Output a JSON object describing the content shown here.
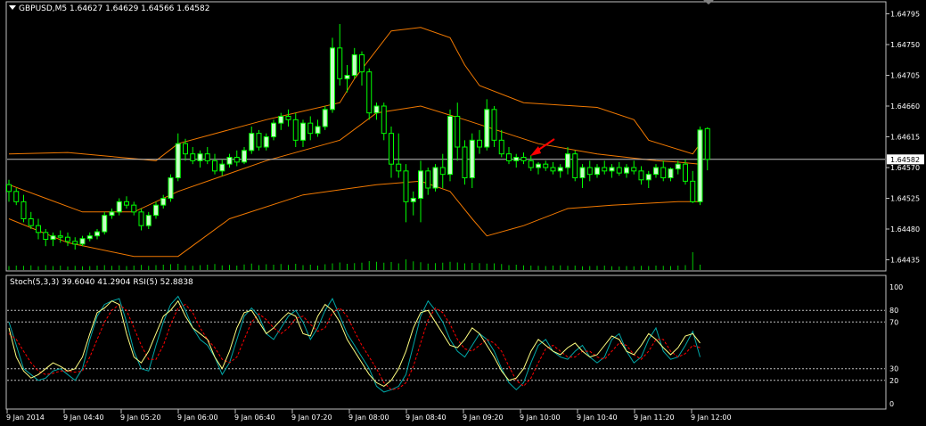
{
  "main_chart": {
    "header": "GBPUSD,M5  1.64627 1.64629 1.64566 1.64582",
    "price_labels": [
      "1.64795",
      "1.64750",
      "1.64705",
      "1.64660",
      "1.64615",
      "1.64570",
      "1.64525",
      "1.64480",
      "1.64435"
    ],
    "current_price_label": "1.64582",
    "current_price": 1.64582,
    "colors": {
      "bull": "#c8ffc8",
      "bear": "#000000",
      "wick": "#00ff00",
      "bands": "#f07800",
      "volume": "#00c800",
      "grid": "#c0c0c0",
      "arrow": "#ff0000",
      "price_line": "#c0c0c0"
    }
  },
  "indicator": {
    "header": "Stoch(5,3,3) 39.6040 41.2904  RSI(5) 52.8838",
    "levels": [
      "100",
      "80",
      "70",
      "30",
      "20",
      "0"
    ],
    "colors": {
      "stoch_main": "#00a8a8",
      "stoch_signal": "#ff0000",
      "rsi": "#ffff80"
    }
  },
  "time_axis": {
    "labels": [
      "9 Jan 2014",
      "9 Jan 04:40",
      "9 Jan 05:20",
      "9 Jan 06:00",
      "9 Jan 06:40",
      "9 Jan 07:20",
      "9 Jan 08:00",
      "9 Jan 08:40",
      "9 Jan 09:20",
      "9 Jan 10:00",
      "9 Jan 10:40",
      "9 Jan 11:20",
      "9 Jan 12:00"
    ]
  },
  "chart_data": {
    "type": "candlestick",
    "symbol": "GBPUSD",
    "timeframe": "M5",
    "ohlc_last": {
      "open": 1.64627,
      "high": 1.64629,
      "low": 1.64566,
      "close": 1.64582
    },
    "ylim": [
      1.6442,
      1.6481
    ],
    "candles": [
      [
        1.64545,
        1.64552,
        1.6452,
        1.64535
      ],
      [
        1.64535,
        1.6454,
        1.64515,
        1.6452
      ],
      [
        1.6452,
        1.6453,
        1.6449,
        1.64495
      ],
      [
        1.64495,
        1.64505,
        1.6448,
        1.64485
      ],
      [
        1.64485,
        1.64495,
        1.64465,
        1.64475
      ],
      [
        1.64475,
        1.6448,
        1.64455,
        1.64465
      ],
      [
        1.64465,
        1.64475,
        1.64455,
        1.6447
      ],
      [
        1.6447,
        1.64478,
        1.6446,
        1.64468
      ],
      [
        1.64468,
        1.64475,
        1.64455,
        1.64462
      ],
      [
        1.64462,
        1.64468,
        1.6445,
        1.64458
      ],
      [
        1.64458,
        1.6447,
        1.64455,
        1.64466
      ],
      [
        1.64466,
        1.64475,
        1.64462,
        1.6447
      ],
      [
        1.6447,
        1.6448,
        1.64465,
        1.64476
      ],
      [
        1.64476,
        1.64505,
        1.64472,
        1.645
      ],
      [
        1.645,
        1.6451,
        1.64495,
        1.64505
      ],
      [
        1.64505,
        1.64525,
        1.645,
        1.6452
      ],
      [
        1.6452,
        1.64528,
        1.6451,
        1.64515
      ],
      [
        1.64515,
        1.6452,
        1.645,
        1.64505
      ],
      [
        1.64505,
        1.6451,
        1.64478,
        1.64485
      ],
      [
        1.64485,
        1.64505,
        1.6448,
        1.645
      ],
      [
        1.645,
        1.6452,
        1.64495,
        1.64515
      ],
      [
        1.64515,
        1.6453,
        1.6451,
        1.64525
      ],
      [
        1.64525,
        1.6456,
        1.6452,
        1.64555
      ],
      [
        1.64555,
        1.6462,
        1.6455,
        1.64605
      ],
      [
        1.64605,
        1.64612,
        1.6458,
        1.6459
      ],
      [
        1.6459,
        1.646,
        1.64575,
        1.6458
      ],
      [
        1.6458,
        1.64595,
        1.6457,
        1.6459
      ],
      [
        1.6459,
        1.646,
        1.64575,
        1.6458
      ],
      [
        1.6458,
        1.6459,
        1.6456,
        1.64565
      ],
      [
        1.64565,
        1.64582,
        1.64558,
        1.64575
      ],
      [
        1.64575,
        1.6459,
        1.6457,
        1.64585
      ],
      [
        1.64585,
        1.64595,
        1.64572,
        1.64578
      ],
      [
        1.64578,
        1.646,
        1.64575,
        1.64595
      ],
      [
        1.64595,
        1.6463,
        1.6459,
        1.6462
      ],
      [
        1.6462,
        1.64625,
        1.64595,
        1.646
      ],
      [
        1.646,
        1.6462,
        1.64595,
        1.64615
      ],
      [
        1.64615,
        1.6464,
        1.6461,
        1.64635
      ],
      [
        1.64635,
        1.6465,
        1.64625,
        1.64645
      ],
      [
        1.64645,
        1.64655,
        1.6463,
        1.6464
      ],
      [
        1.6464,
        1.6465,
        1.646,
        1.6461
      ],
      [
        1.6461,
        1.6464,
        1.646,
        1.64635
      ],
      [
        1.64635,
        1.64645,
        1.6461,
        1.6462
      ],
      [
        1.6462,
        1.6464,
        1.64615,
        1.6463
      ],
      [
        1.6463,
        1.6466,
        1.64625,
        1.64655
      ],
      [
        1.64655,
        1.6476,
        1.6465,
        1.64745
      ],
      [
        1.64745,
        1.6478,
        1.6469,
        1.647
      ],
      [
        1.647,
        1.6472,
        1.6468,
        1.64705
      ],
      [
        1.64705,
        1.64745,
        1.647,
        1.64735
      ],
      [
        1.64735,
        1.6474,
        1.6469,
        1.6471
      ],
      [
        1.6471,
        1.64715,
        1.6464,
        1.6465
      ],
      [
        1.6465,
        1.64665,
        1.6464,
        1.6466
      ],
      [
        1.6466,
        1.64665,
        1.6461,
        1.6462
      ],
      [
        1.6462,
        1.6463,
        1.64555,
        1.64575
      ],
      [
        1.64575,
        1.6462,
        1.64555,
        1.64565
      ],
      [
        1.64565,
        1.64575,
        1.6449,
        1.6452
      ],
      [
        1.6452,
        1.64535,
        1.645,
        1.64525
      ],
      [
        1.64525,
        1.6458,
        1.6449,
        1.64565
      ],
      [
        1.64565,
        1.6457,
        1.6453,
        1.6454
      ],
      [
        1.6454,
        1.64575,
        1.64535,
        1.6457
      ],
      [
        1.6457,
        1.6459,
        1.6454,
        1.6456
      ],
      [
        1.6456,
        1.64655,
        1.6455,
        1.64645
      ],
      [
        1.64645,
        1.64665,
        1.6458,
        1.646
      ],
      [
        1.646,
        1.6461,
        1.64545,
        1.64555
      ],
      [
        1.64555,
        1.6462,
        1.6454,
        1.6461
      ],
      [
        1.6461,
        1.64625,
        1.6459,
        1.646
      ],
      [
        1.646,
        1.6467,
        1.64595,
        1.64655
      ],
      [
        1.64655,
        1.6466,
        1.646,
        1.6461
      ],
      [
        1.6461,
        1.64625,
        1.64585,
        1.6459
      ],
      [
        1.6459,
        1.646,
        1.64575,
        1.6458
      ],
      [
        1.6458,
        1.6459,
        1.6457,
        1.64585
      ],
      [
        1.64585,
        1.64592,
        1.64575,
        1.6458
      ],
      [
        1.6458,
        1.64588,
        1.64565,
        1.6457
      ],
      [
        1.6457,
        1.64578,
        1.6456,
        1.64575
      ],
      [
        1.64575,
        1.6458,
        1.64565,
        1.6457
      ],
      [
        1.6457,
        1.64578,
        1.6456,
        1.64565
      ],
      [
        1.64565,
        1.64575,
        1.64555,
        1.6457
      ],
      [
        1.6457,
        1.646,
        1.6456,
        1.6459
      ],
      [
        1.6459,
        1.64595,
        1.6455,
        1.64555
      ],
      [
        1.64555,
        1.64575,
        1.6454,
        1.6457
      ],
      [
        1.6457,
        1.6458,
        1.6455,
        1.6456
      ],
      [
        1.6456,
        1.64575,
        1.64555,
        1.6457
      ],
      [
        1.6457,
        1.6458,
        1.6456,
        1.64565
      ],
      [
        1.64565,
        1.64575,
        1.64555,
        1.6457
      ],
      [
        1.6457,
        1.64578,
        1.64558,
        1.64562
      ],
      [
        1.64562,
        1.64575,
        1.64555,
        1.6457
      ],
      [
        1.6457,
        1.6458,
        1.6456,
        1.64565
      ],
      [
        1.64565,
        1.64572,
        1.64545,
        1.64552
      ],
      [
        1.64552,
        1.64565,
        1.6454,
        1.6456
      ],
      [
        1.6456,
        1.64575,
        1.64555,
        1.6457
      ],
      [
        1.6457,
        1.6458,
        1.6455,
        1.64555
      ],
      [
        1.64555,
        1.6457,
        1.6455,
        1.64568
      ],
      [
        1.64568,
        1.6458,
        1.6456,
        1.64575
      ],
      [
        1.64575,
        1.64582,
        1.64545,
        1.6455
      ],
      [
        1.6455,
        1.64565,
        1.64518,
        1.6452
      ],
      [
        1.6452,
        1.6463,
        1.64515,
        1.64625
      ],
      [
        1.64627,
        1.64629,
        1.64566,
        1.64582
      ]
    ],
    "volume": [
      18,
      20,
      19,
      21,
      17,
      22,
      18,
      20,
      16,
      19,
      17,
      18,
      20,
      22,
      19,
      21,
      18,
      20,
      23,
      19,
      22,
      24,
      26,
      28,
      21,
      19,
      22,
      24,
      27,
      21,
      23,
      20,
      25,
      29,
      22,
      26,
      24,
      27,
      23,
      28,
      22,
      24,
      20,
      26,
      30,
      34,
      28,
      31,
      33,
      40,
      37,
      33,
      36,
      30,
      48,
      39,
      35,
      29,
      31,
      33,
      37,
      34,
      30,
      32,
      31,
      29,
      30,
      27,
      22,
      24,
      21,
      20,
      19,
      18,
      20,
      21,
      19,
      20,
      17,
      18,
      19,
      20,
      17,
      16,
      18,
      17,
      19,
      18,
      20,
      19,
      18,
      20,
      22,
      80,
      24
    ],
    "bollinger": {
      "upper": [
        [
          0,
          1.6459
        ],
        [
          8,
          1.64592
        ],
        [
          20,
          1.6458
        ],
        [
          23,
          1.64605
        ],
        [
          35,
          1.6464
        ],
        [
          45,
          1.64665
        ],
        [
          47,
          1.647
        ],
        [
          52,
          1.6477
        ],
        [
          56,
          1.64775
        ],
        [
          60,
          1.6476
        ],
        [
          62,
          1.6472
        ],
        [
          64,
          1.6469
        ],
        [
          70,
          1.64665
        ],
        [
          80,
          1.64658
        ],
        [
          85,
          1.6464
        ],
        [
          87,
          1.6461
        ],
        [
          93,
          1.6459
        ],
        [
          94,
          1.64605
        ]
      ],
      "middle": [
        [
          0,
          1.64545
        ],
        [
          5,
          1.64525
        ],
        [
          10,
          1.64505
        ],
        [
          17,
          1.64505
        ],
        [
          23,
          1.64535
        ],
        [
          35,
          1.6458
        ],
        [
          45,
          1.6461
        ],
        [
          50,
          1.6465
        ],
        [
          56,
          1.6466
        ],
        [
          62,
          1.6464
        ],
        [
          72,
          1.64605
        ],
        [
          80,
          1.6459
        ],
        [
          88,
          1.6458
        ],
        [
          91,
          1.64578
        ],
        [
          94,
          1.64575
        ]
      ],
      "lower": [
        [
          0,
          1.64495
        ],
        [
          8,
          1.6446
        ],
        [
          17,
          1.6444
        ],
        [
          23,
          1.6444
        ],
        [
          30,
          1.64495
        ],
        [
          40,
          1.6453
        ],
        [
          50,
          1.64545
        ],
        [
          56,
          1.6455
        ],
        [
          60,
          1.64535
        ],
        [
          63,
          1.64495
        ],
        [
          65,
          1.6447
        ],
        [
          70,
          1.64485
        ],
        [
          76,
          1.6451
        ],
        [
          82,
          1.64515
        ],
        [
          91,
          1.6452
        ],
        [
          94,
          1.6452
        ]
      ]
    },
    "stochastic_main": [
      70,
      50,
      30,
      25,
      20,
      22,
      28,
      30,
      25,
      20,
      30,
      55,
      75,
      85,
      88,
      90,
      70,
      45,
      30,
      28,
      50,
      70,
      85,
      92,
      80,
      65,
      55,
      50,
      40,
      25,
      35,
      55,
      75,
      82,
      75,
      60,
      55,
      65,
      75,
      80,
      70,
      55,
      65,
      80,
      90,
      75,
      60,
      50,
      40,
      30,
      15,
      10,
      12,
      15,
      25,
      50,
      75,
      88,
      80,
      70,
      55,
      45,
      40,
      50,
      60,
      55,
      45,
      30,
      18,
      12,
      18,
      35,
      50,
      55,
      45,
      40,
      38,
      45,
      50,
      40,
      35,
      40,
      55,
      60,
      45,
      35,
      40,
      55,
      65,
      45,
      38,
      40,
      50,
      62,
      40
    ],
    "stochastic_signal": [
      60,
      55,
      45,
      35,
      28,
      25,
      26,
      28,
      28,
      27,
      28,
      40,
      55,
      70,
      80,
      85,
      80,
      65,
      50,
      38,
      38,
      50,
      68,
      82,
      85,
      78,
      65,
      55,
      48,
      38,
      35,
      40,
      55,
      70,
      77,
      72,
      65,
      60,
      65,
      73,
      75,
      68,
      62,
      65,
      78,
      82,
      75,
      62,
      50,
      40,
      30,
      18,
      12,
      13,
      18,
      32,
      52,
      72,
      82,
      78,
      68,
      55,
      47,
      45,
      50,
      55,
      52,
      45,
      32,
      20,
      15,
      22,
      35,
      47,
      50,
      45,
      40,
      40,
      45,
      45,
      40,
      38,
      45,
      52,
      50,
      42,
      38,
      45,
      55,
      55,
      45,
      40,
      43,
      50,
      48
    ],
    "rsi": [
      65,
      40,
      28,
      22,
      25,
      30,
      35,
      32,
      28,
      30,
      40,
      60,
      78,
      82,
      88,
      85,
      60,
      40,
      35,
      45,
      60,
      75,
      80,
      88,
      75,
      65,
      60,
      55,
      40,
      30,
      45,
      65,
      78,
      80,
      70,
      60,
      65,
      72,
      78,
      75,
      60,
      58,
      75,
      85,
      80,
      70,
      55,
      45,
      35,
      25,
      18,
      15,
      20,
      30,
      45,
      65,
      78,
      80,
      70,
      60,
      50,
      48,
      55,
      65,
      60,
      50,
      40,
      28,
      20,
      22,
      30,
      45,
      55,
      50,
      45,
      42,
      48,
      52,
      45,
      40,
      42,
      50,
      58,
      55,
      45,
      42,
      50,
      60,
      55,
      48,
      42,
      48,
      58,
      60,
      52
    ]
  }
}
